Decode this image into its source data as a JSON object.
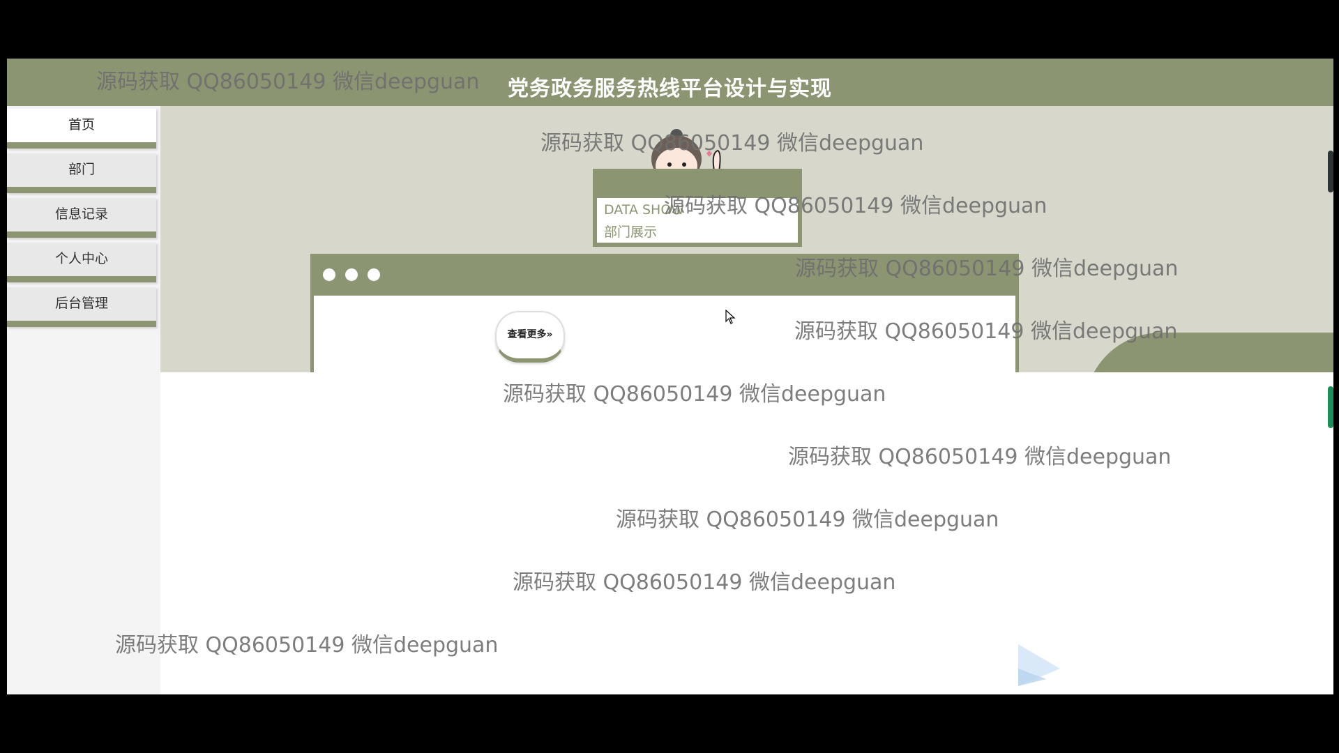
{
  "header": {
    "title": "党务政务服务热线平台设计与实现"
  },
  "sidebar": {
    "items": [
      {
        "label": "首页",
        "active": true
      },
      {
        "label": "部门",
        "active": false
      },
      {
        "label": "信息记录",
        "active": false
      },
      {
        "label": "个人中心",
        "active": false
      },
      {
        "label": "后台管理",
        "active": false
      }
    ]
  },
  "section": {
    "title_en": "DATA SHOW",
    "title_cn": "部门展示",
    "more_label": "查看更多»"
  },
  "watermark": "源码获取 QQ86050149 微信deepguan",
  "colors": {
    "accent": "#8b9571",
    "hero_bg": "#d7d8cb",
    "sidebar_bg": "#f4f4f4"
  }
}
